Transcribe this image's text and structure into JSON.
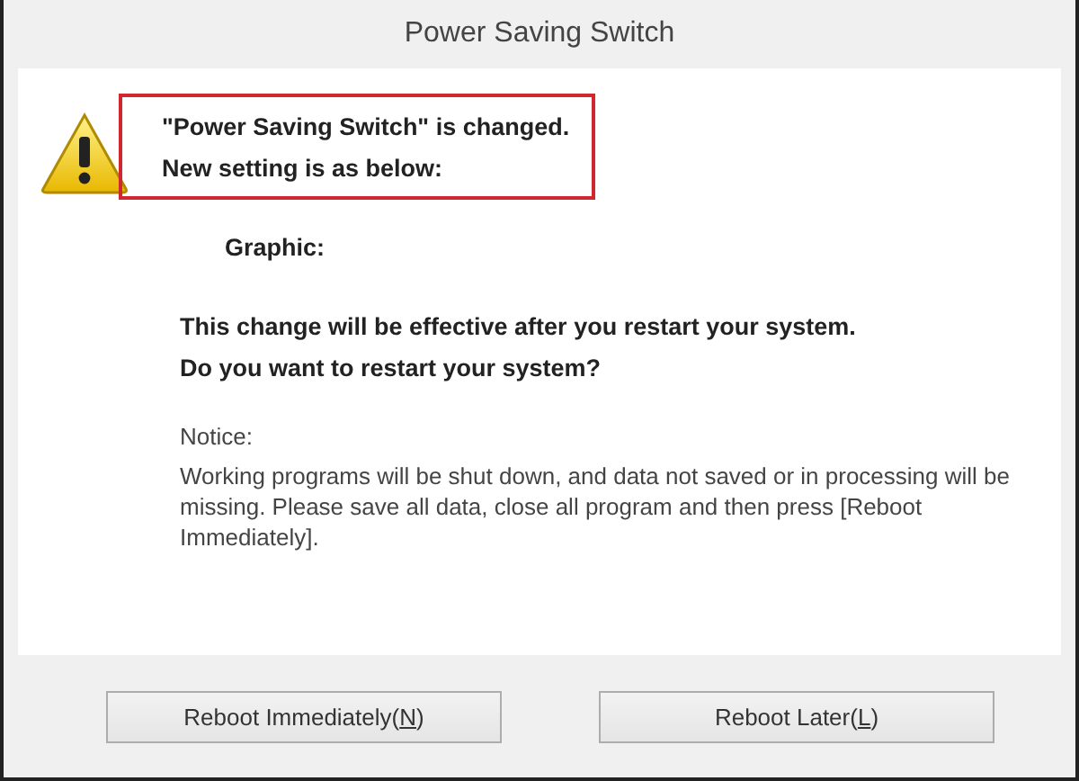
{
  "window": {
    "title": "Power Saving Switch"
  },
  "header": {
    "highlighted": true,
    "lines": [
      "\"Power Saving Switch\" is changed.",
      "New setting is as below:"
    ]
  },
  "setting_label": "Graphic:",
  "question": [
    "This change will be effective after you restart your system.",
    "Do you want to restart your system?"
  ],
  "notice": {
    "title": "Notice:",
    "text": "Working programs will be shut down, and data not saved or in processing will be missing. Please save all data, close all program and then press [Reboot Immediately]."
  },
  "buttons": [
    {
      "prefix": "Reboot Immediately(",
      "key": "N",
      "suffix": ")"
    },
    {
      "prefix": "Reboot Later(",
      "key": "L",
      "suffix": ")"
    }
  ]
}
